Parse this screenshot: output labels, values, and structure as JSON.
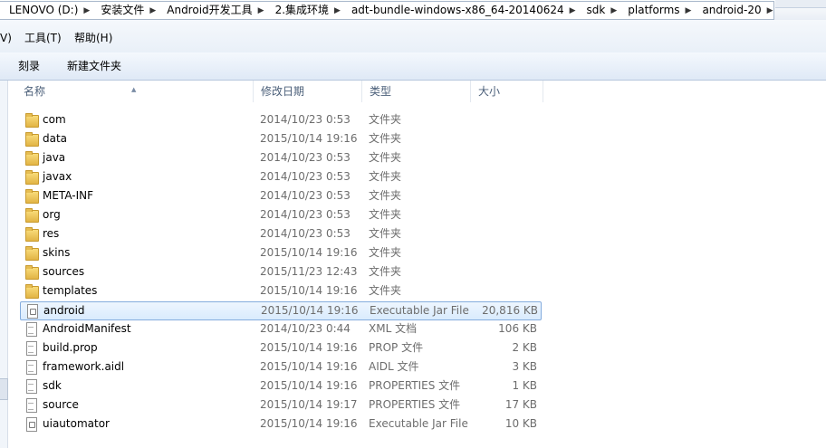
{
  "address": {
    "crumbs": [
      "LENOVO (D:)",
      "安装文件",
      "Android开发工具",
      "2.集成环境",
      "adt-bundle-windows-x86_64-20140624",
      "sdk",
      "platforms",
      "android-20"
    ]
  },
  "menu": {
    "view": "V)",
    "tools": "工具(T)",
    "help": "帮助(H)"
  },
  "toolbar": {
    "burn": "刻录",
    "new_folder": "新建文件夹"
  },
  "columns": {
    "name": "名称",
    "date": "修改日期",
    "type": "类型",
    "size": "大小"
  },
  "files": [
    {
      "name": "com",
      "date": "2014/10/23 0:53",
      "type": "文件夹",
      "size": "",
      "icon": "folder-icon"
    },
    {
      "name": "data",
      "date": "2015/10/14 19:16",
      "type": "文件夹",
      "size": "",
      "icon": "folder-icon"
    },
    {
      "name": "java",
      "date": "2014/10/23 0:53",
      "type": "文件夹",
      "size": "",
      "icon": "folder-icon"
    },
    {
      "name": "javax",
      "date": "2014/10/23 0:53",
      "type": "文件夹",
      "size": "",
      "icon": "folder-icon"
    },
    {
      "name": "META-INF",
      "date": "2014/10/23 0:53",
      "type": "文件夹",
      "size": "",
      "icon": "folder-icon"
    },
    {
      "name": "org",
      "date": "2014/10/23 0:53",
      "type": "文件夹",
      "size": "",
      "icon": "folder-icon"
    },
    {
      "name": "res",
      "date": "2014/10/23 0:53",
      "type": "文件夹",
      "size": "",
      "icon": "folder-icon"
    },
    {
      "name": "skins",
      "date": "2015/10/14 19:16",
      "type": "文件夹",
      "size": "",
      "icon": "folder-icon"
    },
    {
      "name": "sources",
      "date": "2015/11/23 12:43",
      "type": "文件夹",
      "size": "",
      "icon": "folder-icon"
    },
    {
      "name": "templates",
      "date": "2015/10/14 19:16",
      "type": "文件夹",
      "size": "",
      "icon": "folder-icon"
    },
    {
      "name": "android",
      "date": "2015/10/14 19:16",
      "type": "Executable Jar File",
      "size": "20,816 KB",
      "icon": "jar-icon",
      "selected": true
    },
    {
      "name": "AndroidManifest",
      "date": "2014/10/23 0:44",
      "type": "XML 文档",
      "size": "106 KB",
      "icon": "file-icon"
    },
    {
      "name": "build.prop",
      "date": "2015/10/14 19:16",
      "type": "PROP 文件",
      "size": "2 KB",
      "icon": "file-icon"
    },
    {
      "name": "framework.aidl",
      "date": "2015/10/14 19:16",
      "type": "AIDL 文件",
      "size": "3 KB",
      "icon": "file-icon"
    },
    {
      "name": "sdk",
      "date": "2015/10/14 19:16",
      "type": "PROPERTIES 文件",
      "size": "1 KB",
      "icon": "file-icon"
    },
    {
      "name": "source",
      "date": "2015/10/14 19:17",
      "type": "PROPERTIES 文件",
      "size": "17 KB",
      "icon": "file-icon"
    },
    {
      "name": "uiautomator",
      "date": "2015/10/14 19:16",
      "type": "Executable Jar File",
      "size": "10 KB",
      "icon": "jar-icon"
    }
  ]
}
